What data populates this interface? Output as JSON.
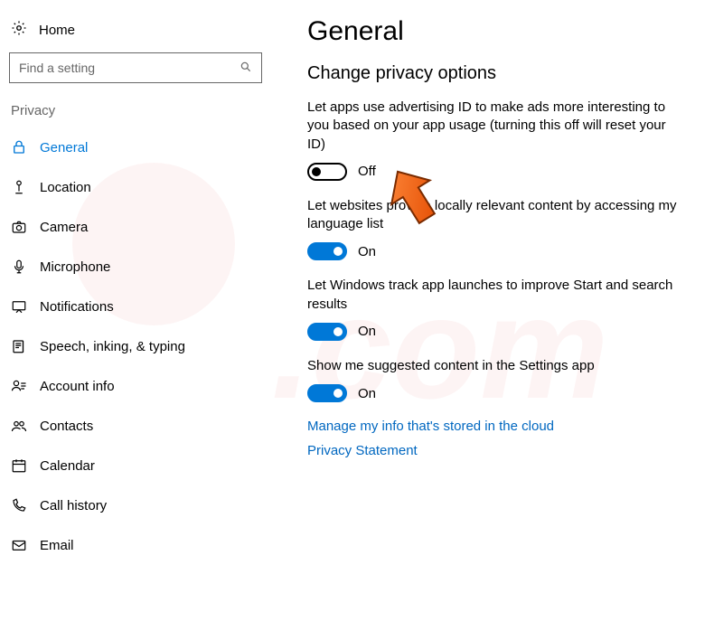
{
  "home_label": "Home",
  "search_placeholder": "Find a setting",
  "section_title": "Privacy",
  "nav": [
    {
      "label": "General",
      "active": true,
      "icon": "lock"
    },
    {
      "label": "Location",
      "active": false,
      "icon": "location"
    },
    {
      "label": "Camera",
      "active": false,
      "icon": "camera"
    },
    {
      "label": "Microphone",
      "active": false,
      "icon": "mic"
    },
    {
      "label": "Notifications",
      "active": false,
      "icon": "notif"
    },
    {
      "label": "Speech, inking, & typing",
      "active": false,
      "icon": "speech"
    },
    {
      "label": "Account info",
      "active": false,
      "icon": "account"
    },
    {
      "label": "Contacts",
      "active": false,
      "icon": "contacts"
    },
    {
      "label": "Calendar",
      "active": false,
      "icon": "calendar"
    },
    {
      "label": "Call history",
      "active": false,
      "icon": "callhistory"
    },
    {
      "label": "Email",
      "active": false,
      "icon": "email"
    }
  ],
  "page_title": "General",
  "subheading": "Change privacy options",
  "settings": [
    {
      "desc": "Let apps use advertising ID to make ads more interesting to you based on your app usage (turning this off will reset your ID)",
      "state": "Off",
      "on": false
    },
    {
      "desc": "Let websites provide locally relevant content by accessing my language list",
      "state": "On",
      "on": true
    },
    {
      "desc": "Let Windows track app launches to improve Start and search results",
      "state": "On",
      "on": true
    },
    {
      "desc": "Show me suggested content in the Settings app",
      "state": "On",
      "on": true
    }
  ],
  "links": [
    "Manage my info that's stored in the cloud",
    "Privacy Statement"
  ]
}
